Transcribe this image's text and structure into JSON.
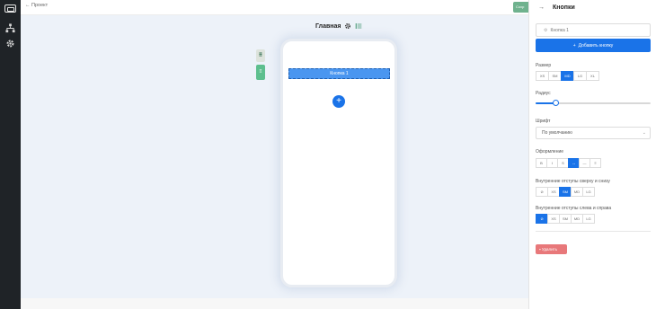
{
  "rail": {
    "logo_icon": "app-logo-icon",
    "items": [
      {
        "icon": "hierarchy-icon"
      },
      {
        "icon": "gear-icon"
      }
    ]
  },
  "topbar": {
    "back_label": "← Проект",
    "save_label": "Сохр"
  },
  "canvas": {
    "page_title": "Главная",
    "tool_a": "⠿",
    "tool_b": "⠿"
  },
  "phone": {
    "button_label": "Кнопка 1",
    "add_symbol": "+"
  },
  "panel": {
    "title": "Кнопки",
    "back_arrow": "→",
    "button_item": "Кнопка 1",
    "add_button": "Добавить кнопку",
    "size": {
      "label": "Размер",
      "options": [
        "XS",
        "SM",
        "MD",
        "LG",
        "XL"
      ],
      "selected": "MD"
    },
    "radius": {
      "label": "Радиус",
      "value": 0.17
    },
    "font": {
      "label": "Шрифт",
      "value": "По умолчанию"
    },
    "style": {
      "label": "Оформление",
      "options": [
        "B",
        "I",
        "S",
        "↔",
        "—",
        "≡"
      ],
      "selected": "↔"
    },
    "padding_v": {
      "label": "Внутренние отступы сверху и снизу",
      "options": [
        "⊘",
        "XS",
        "SM",
        "MD",
        "LG"
      ],
      "selected": "SM"
    },
    "padding_h": {
      "label": "Внутренние отступы слева и справа",
      "options": [
        "⊘",
        "XS",
        "SM",
        "MD",
        "LG"
      ],
      "selected": "⊘"
    },
    "delete_label": "Удалить"
  },
  "colors": {
    "accent": "#1a73e8",
    "delete": "#e8787a",
    "save": "#6fb28e",
    "rail": "#1f2327",
    "canvas": "#edf2f9"
  }
}
